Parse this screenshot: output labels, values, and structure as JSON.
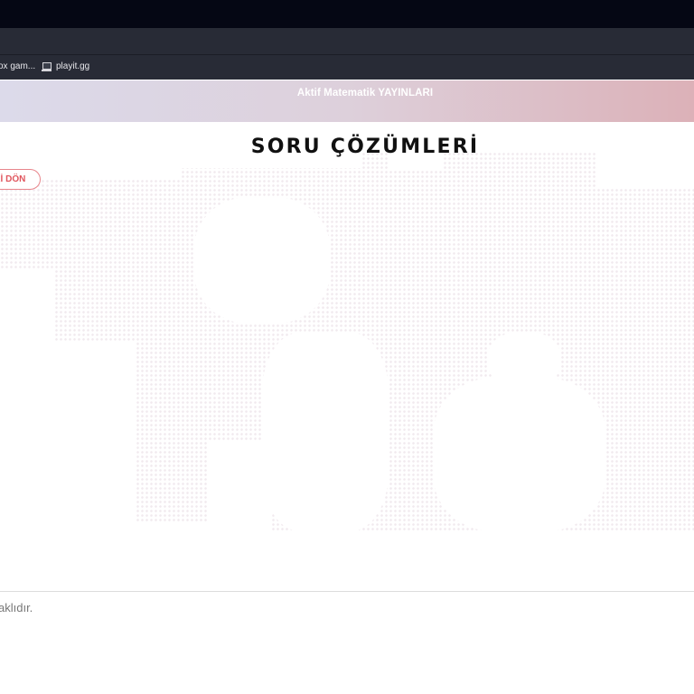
{
  "browser": {
    "bookmarks": [
      {
        "label": "ox gam..."
      },
      {
        "label": "playit.gg"
      }
    ]
  },
  "site": {
    "brand": "Aktif Matematik YAYINLARI"
  },
  "main": {
    "title": "SORU ÇÖZÜMLERİ",
    "back_label": "ERİ DÖN"
  },
  "footer": {
    "text": "aklıdır."
  },
  "colors": {
    "accent": "#e0555d",
    "header_gradient_start": "#dcdaea",
    "header_gradient_end": "#dcb1b8"
  }
}
